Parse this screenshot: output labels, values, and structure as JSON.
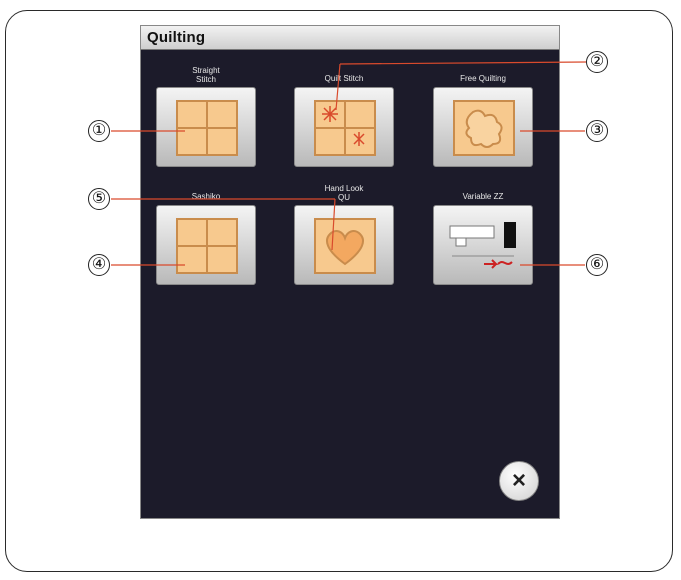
{
  "window": {
    "title": "Quilting"
  },
  "buttons": [
    {
      "label_line1": "Straight",
      "label_line2": "Stitch",
      "icon": "four-square-quilt-icon"
    },
    {
      "label_line1": "Quilt Stitch",
      "label_line2": "",
      "icon": "quilt-stitch-squares-icon"
    },
    {
      "label_line1": "Free Quilting",
      "label_line2": "",
      "icon": "puzzle-shape-icon"
    },
    {
      "label_line1": "Sashiko",
      "label_line2": "",
      "icon": "four-square-quilt-icon"
    },
    {
      "label_line1": "Hand Look",
      "label_line2": "QU",
      "icon": "heart-icon"
    },
    {
      "label_line1": "Variable ZZ",
      "label_line2": "",
      "icon": "knee-lifter-icon"
    }
  ],
  "close": {
    "label": "×"
  },
  "callouts": [
    "①",
    "②",
    "③",
    "④",
    "⑤",
    "⑥"
  ],
  "colors": {
    "screen_bg": "#1c1b2a",
    "tile": "#f7c98e",
    "tile_line": "#c98c4c",
    "stitch_red": "#d94a2c"
  }
}
